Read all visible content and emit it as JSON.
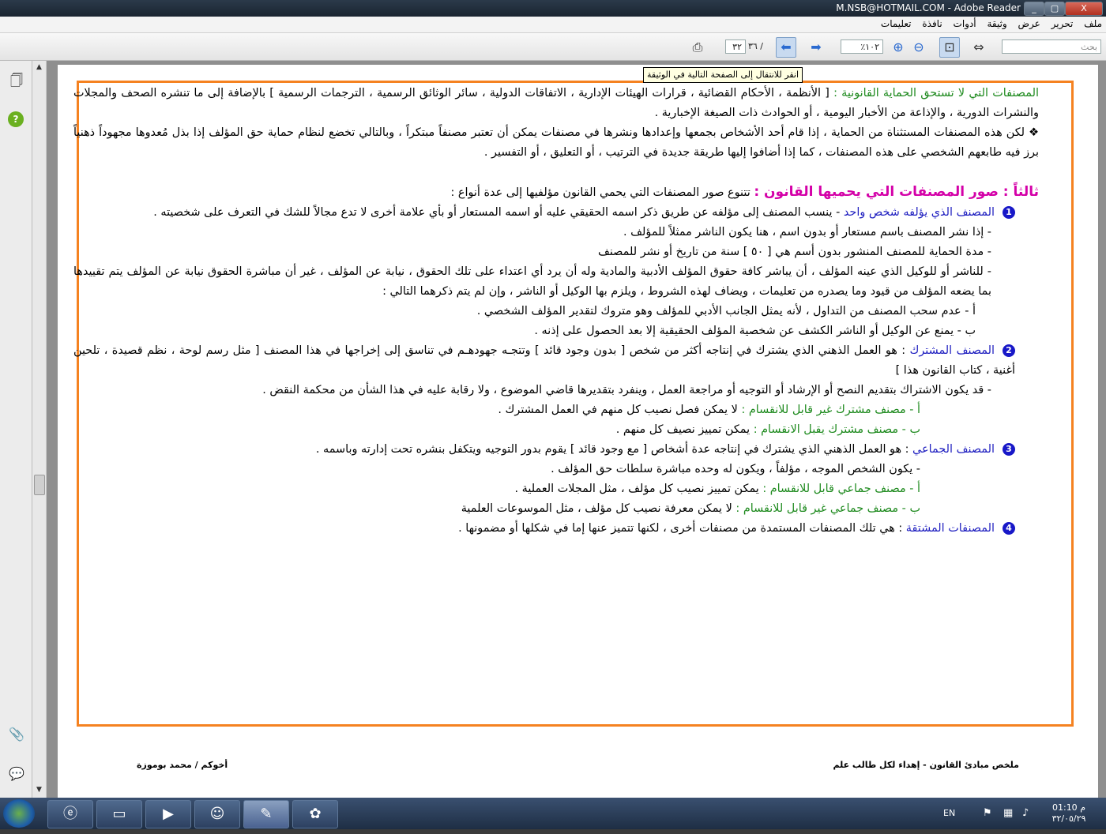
{
  "window": {
    "title": "M.NSB@HOTMAIL.COM - Adobe Reader",
    "min": "_",
    "max": "▢",
    "close": "X"
  },
  "menu": [
    "ملف",
    "تحرير",
    "عرض",
    "وثيقة",
    "أدوات",
    "نافذة",
    "تعليمات"
  ],
  "toolbar": {
    "page_current": "٣٢",
    "page_total": "/ ٣٦",
    "zoom": "١٠٢٪",
    "search_placeholder": "بحث",
    "tooltip": "انقر للانتقال إلى الصفحة التالية في الوثيقة"
  },
  "doc": {
    "p1_green": "المصنفات التي لا تستحق الحماية القانونية :",
    "p1_text": " [ الأنظمة ، الأحكام القضائية ، قرارات الهيئات الإدارية ، الاتفاقات الدولية ، سائر الوثائق الرسمية ، الترجمات الرسمية ] بالإضافة إلى ما تنشره الصحف والمجلات والنشرات الدورية ، والإذاعة من الأخبار اليومية ، أو الحوادث ذات الصيغة الإخبارية .",
    "p2": "❖  لكن هذه المصنفات المستثناة من الحماية ، إذا قام أحد الأشخاص بجمعها وإعدادها ونشرها في مصنفات يمكن أن تعتبر مصنفاً مبتكراً ، وبالتالي تخضع لنظام حماية حق المؤلف إذا بذل مُعدوها مجهوداً ذهنياً برز فيه طابعهم الشخصي على هذه المصنفات ، كما إذا أضافوا إليها طريقة جديدة في الترتيب ، أو التعليق ، أو التفسير .",
    "heading3": "ثالثاً : صور المصنفات التي يحميها القانون :",
    "heading3_text": "  تتنوع صور المصنفات التي يحمي القانون مؤلفيها إلى عدة أنواع :",
    "n1": "1",
    "n1_label": "المصنف الذي يؤلفه شخص واحد",
    "n1_text": "  -  ينسب المصنف إلى مؤلفه عن طريق ذكر اسمه الحقيقي عليه أو اسمه المستعار أو بأي علامة أخرى لا تدع مجالاً للشك في التعرف على شخصيته .",
    "b1": "-   إذا نشر المصنف باسم مستعار أو بدون اسم ، هنا يكون الناشر ممثلاً للمؤلف .",
    "b2": "-   مدة الحماية للمصنف المنشور بدون أسم هي [ ٥٠ ] سنة من تاريخ أو نشر للمصنف",
    "b3": "-   للناشر أو للوكيل الذي عينه المؤلف ، أن يباشر كافة حقوق المؤلف الأدبية والمادية وله أن يرد أي اعتداء على تلك الحقوق ، نيابة عن المؤلف ، غير أن مباشرة الحقوق نيابة عن المؤلف يتم تقييدها بما يضعه المؤلف من قيود وما يصدره من تعليمات ، ويضاف لهذه الشروط ، ويلزم بها الوكيل أو الناشر ، وإن لم يتم ذكرهما التالي :",
    "b3a": "أ - عدم سحب المصنف من التداول ، لأنه يمثل الجانب الأدبي للمؤلف وهو متروك لتقدير المؤلف الشخصي .",
    "b3b": "ب - يمنع عن الوكيل أو الناشر الكشف عن شخصية المؤلف الحقيقية إلا بعد الحصول على إذنه .",
    "n2": "2",
    "n2_label": "المصنف المشترك",
    "n2_text": " : هو العمل الذهني الذي يشترك في إنتاجه أكثر من شخص [ بدون وجود قائد ] وتتجـه جهودهـم في تناسق إلى إخراجها في هذا المصنف [ مثل رسم لوحة ، نظم قصيدة ، تلحين أغنية ، كتاب القانون هذا ]",
    "n2_b1": "-   قد يكون الاشتراك بتقديم النصح أو الإرشاد أو التوجيه أو مراجعة العمل ، وينفرد بتقديرها قاضي الموضوع ، ولا رقابة عليه في هذا الشأن من محكمة النقض .",
    "n2_a_label": "أ -   مصنف مشترك غير قابل للانقسام :",
    "n2_a_text": " لا يمكن فصل نصيب كل منهم في العمل المشترك .",
    "n2_b_label": "ب -   مصنف مشترك يقبل الانقسام :",
    "n2_b_text": " يمكن تمييز نصيف كل منهم .",
    "n3": "3",
    "n3_label": "المصنف الجماعي",
    "n3_text": " :  هو العمل الذهني الذي يشترك في إنتاجه عدة أشخاص [ مع وجود قائد ] يقوم بدور التوجيه ويتكفل بنشره تحت إدارته وباسمه .",
    "n3_b1": "-   يكون الشخص الموجه ، مؤلفاً ، ويكون له وحده مباشرة سلطات حق المؤلف .",
    "n3_a_label": "أ -   مصنف جماعي قابل للانقسام :",
    "n3_a_text": " يمكن تمييز نصيب كل مؤلف ، مثل المجلات العملية .",
    "n3_b_label": "ب -   مصنف جماعي غير قابل للانقسام :",
    "n3_b_text": " لا يمكن معرفة نصيب كل مؤلف ، مثل الموسوعات العلمية",
    "n4": "4",
    "n4_label": "المصنفات المشتقة",
    "n4_text": " : هي تلك المصنفات المستمدة من مصنفات أخرى ، لكنها تتميز عنها إما في شكلها أو مضمونها ."
  },
  "footer": {
    "right": "ملخص مبادئ القانون  -   إهداء لكل طالب علم",
    "left": "أخوكم  /  محمد بوموزة"
  },
  "tray": {
    "lang": "EN",
    "time": "01:10 م",
    "date": "٣٢/٠٥/٢٩"
  },
  "icons": [
    "windows-start-icon",
    "internet-explorer-icon",
    "folder-icon",
    "media-player-icon",
    "users-icon",
    "adobe-reader-icon",
    "paint-icon"
  ]
}
